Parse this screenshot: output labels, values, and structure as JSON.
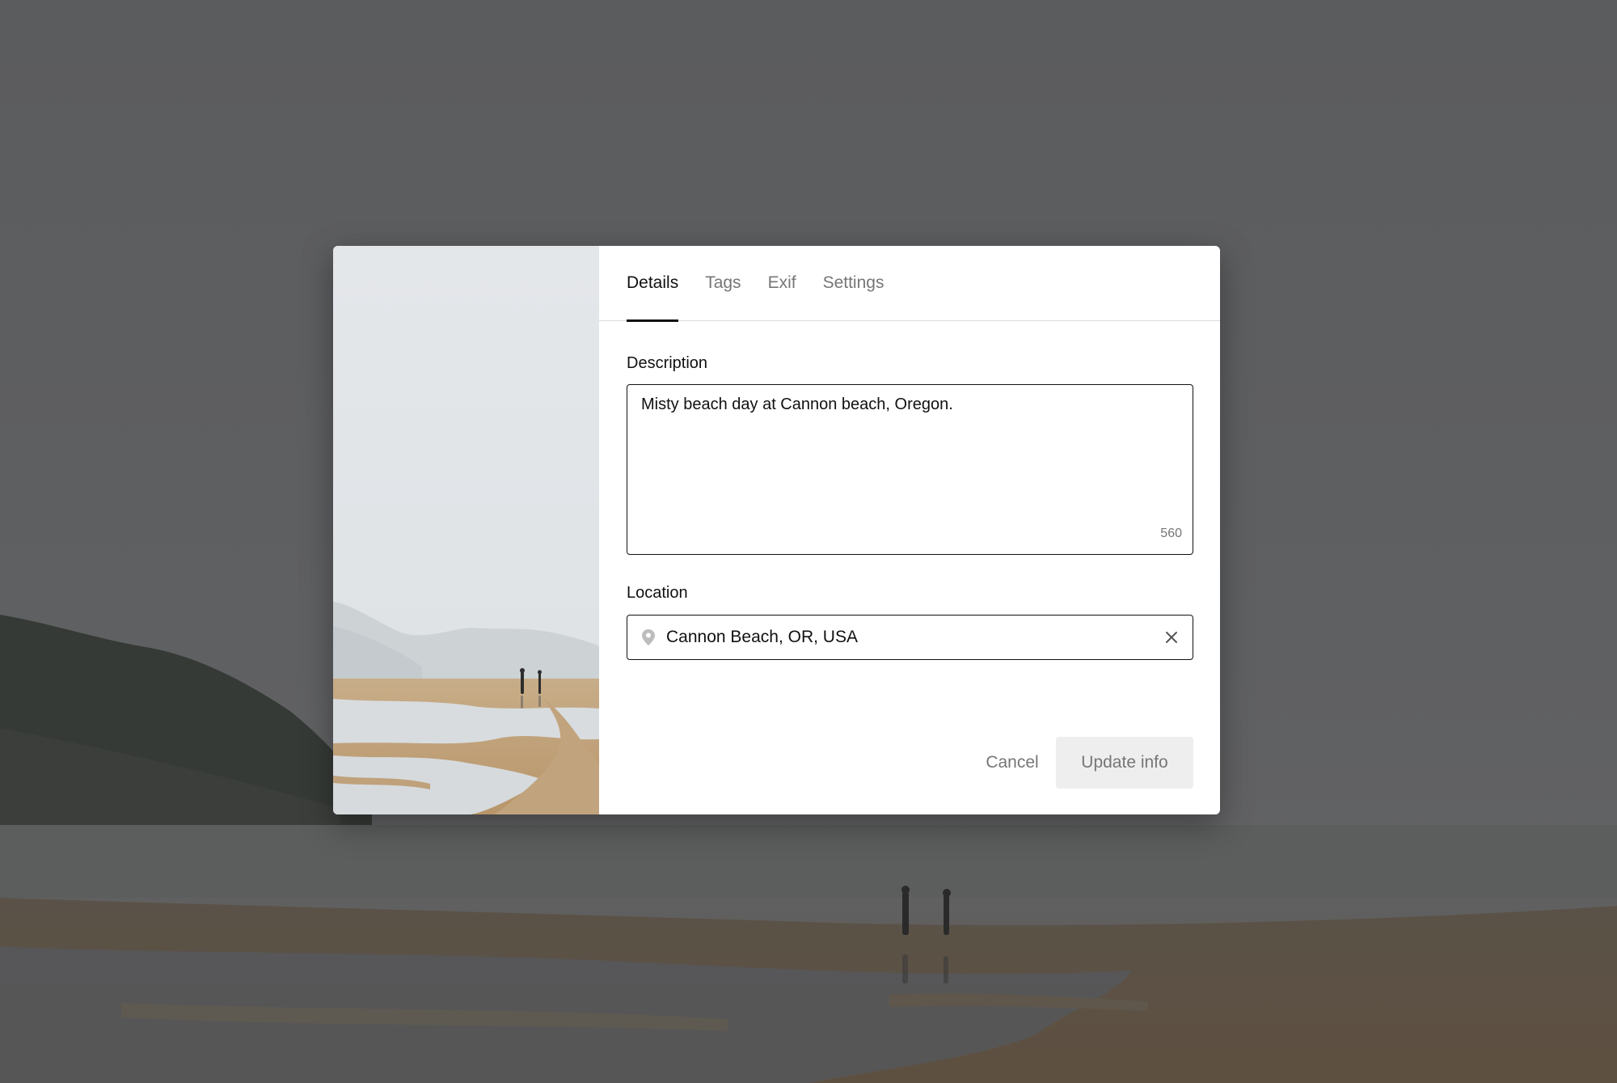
{
  "tabs": [
    {
      "label": "Details",
      "active": true
    },
    {
      "label": "Tags",
      "active": false
    },
    {
      "label": "Exif",
      "active": false
    },
    {
      "label": "Settings",
      "active": false
    }
  ],
  "description": {
    "label": "Description",
    "value": "Misty beach day at Cannon beach, Oregon.",
    "char_count": "560"
  },
  "location": {
    "label": "Location",
    "value": "Cannon Beach, OR, USA",
    "icon": "map-pin-icon",
    "clear_icon": "close-icon"
  },
  "actions": {
    "cancel_label": "Cancel",
    "update_label": "Update info"
  },
  "colors": {
    "overlay": "#5b5c5e",
    "text_primary": "#111111",
    "text_muted": "#767676",
    "button_disabled_bg": "#eeeeee"
  }
}
